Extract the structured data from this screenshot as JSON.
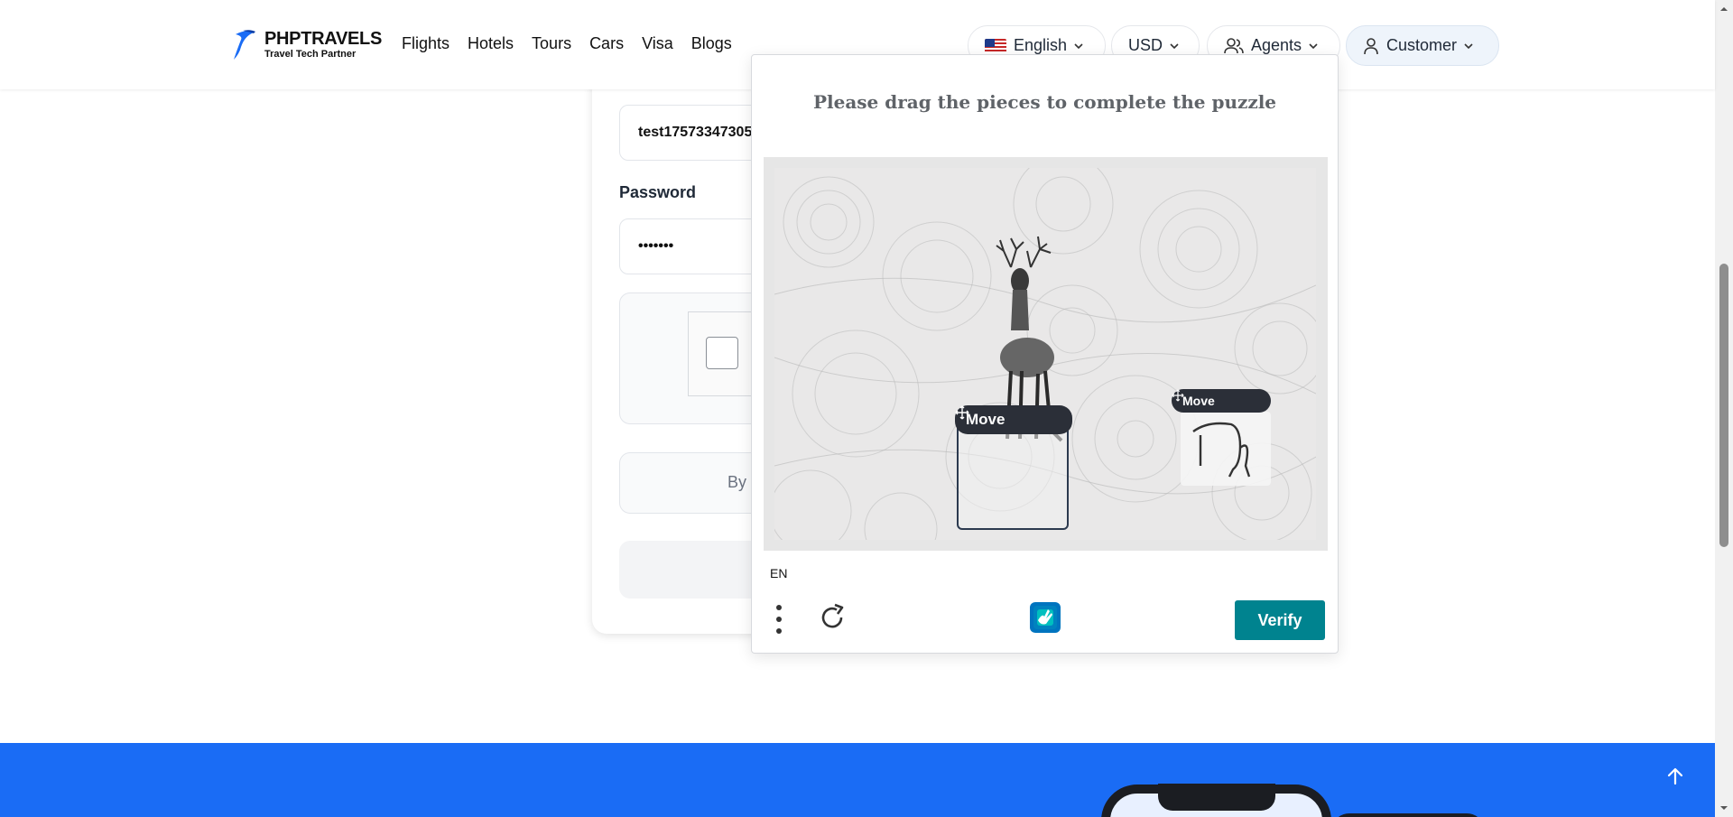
{
  "header": {
    "brand_title": "PHPTRAVELS",
    "brand_subtitle": "Travel Tech Partner",
    "nav": [
      "Flights",
      "Hotels",
      "Tours",
      "Cars",
      "Visa",
      "Blogs"
    ],
    "language": "English",
    "currency": "USD",
    "agents": "Agents",
    "customer": "Customer"
  },
  "login": {
    "email_value": "test17573347305",
    "password_label": "Password",
    "password_value": "•••••••",
    "terms_partial": "By"
  },
  "captcha": {
    "prompt": "Please drag the pieces to complete the puzzle",
    "move_label": "Move",
    "language_code": "EN",
    "verify_label": "Verify",
    "accent_color": "#00838f"
  },
  "icons": {
    "flag": "us-flag-icon",
    "chevron": "chevron-down-icon",
    "agents": "users-icon",
    "customer": "user-icon",
    "move": "move-arrows-icon",
    "menu": "vertical-dots-icon",
    "refresh": "refresh-icon",
    "captcha_logo": "hcaptcha-logo-icon",
    "back_to_top": "arrow-up-icon"
  },
  "colors": {
    "footer_blue": "#1a6cf5",
    "customer_bg": "#eef4fb"
  }
}
